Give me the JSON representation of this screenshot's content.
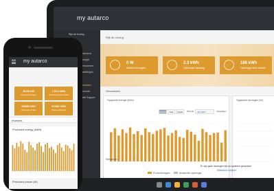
{
  "laptop": {
    "app_name": "my autarco",
    "sidebar": {
      "heading": "Rijk de Koning",
      "items": [
        {
          "label": "Overzicht",
          "active": false
        },
        {
          "label": "Energie",
          "active": false
        },
        {
          "label": "Omvormers",
          "active": false
        },
        {
          "label": "Instellingen",
          "active": false
        },
        {
          "label": "Installatie",
          "active": true
        },
        {
          "label": "Account",
          "active": false
        },
        {
          "label": "Web Support",
          "active": false
        }
      ]
    },
    "breadcrumb": "Rijk de Koning",
    "kpis": [
      {
        "value": "0 W",
        "label": "Actueel vermogen"
      },
      {
        "value": "2.3 kWh",
        "label": "Opbrengst vandaag"
      },
      {
        "value": "186 kWh",
        "label": "Opbrengst deze maand"
      }
    ],
    "section_title": "Omvormers",
    "energy_card": {
      "title": "Opgewekt energie (kWh)",
      "range_tabs": [
        "Maand",
        "Jaar",
        "Totaal"
      ],
      "selected_tab": "Maand",
      "period_label": "Periode",
      "period_value": "Jan 2019",
      "compare_label": "Vergelijken"
    },
    "side_card": {
      "title": "Opgewekt vermogen (W)"
    },
    "legend": [
      "Productiedagen",
      "Verwachte opbrengst"
    ],
    "bottom_title": "Stilstanden",
    "bottom_message": "Er zijn geen storingen bij uw systeem gevonden",
    "bottom_link": "Stilstanden bekijken",
    "accent_color": "#dd9a2e"
  },
  "phone": {
    "app_name": "my autarco",
    "tiles": [
      {
        "value": "15.66 kW",
        "label": "Actueel vermogen"
      },
      {
        "value": "1 514 kWh",
        "label": "Opbrengst deze maand"
      },
      {
        "value": "20835 kWh",
        "label": "Opbrengst dit jaar"
      },
      {
        "value": "32436 kWh",
        "label": "Totale opbrengst"
      }
    ],
    "inverters_label": "Inverters",
    "energy_card_title": "Produced energy (kWh)",
    "power_title": "Produced power (W)"
  },
  "chart_data": [
    {
      "type": "bar",
      "title": "Opgewekt energie (kWh)",
      "categories": [
        "1",
        "2",
        "3",
        "4",
        "5",
        "6",
        "7",
        "8",
        "9",
        "10",
        "11",
        "12",
        "13",
        "14",
        "15",
        "16",
        "17",
        "18",
        "19",
        "20",
        "21",
        "22",
        "23",
        "24",
        "25",
        "26",
        "27",
        "28",
        "29",
        "30",
        "31"
      ],
      "series": [
        {
          "name": "Productiedagen",
          "values": [
            62,
            70,
            55,
            68,
            60,
            72,
            58,
            64,
            56,
            70,
            62,
            58,
            65,
            68,
            71,
            55,
            60,
            66,
            52,
            50,
            67,
            63,
            57,
            44,
            69,
            62,
            56,
            60,
            61,
            40,
            66
          ]
        }
      ],
      "ylim": [
        0,
        80
      ]
    },
    {
      "type": "bar",
      "title": "Produced energy (kWh)",
      "categories": [
        "1",
        "2",
        "3",
        "4",
        "5",
        "6",
        "7",
        "8",
        "9",
        "10",
        "11",
        "12",
        "13",
        "14",
        "15",
        "16",
        "17",
        "18",
        "19",
        "20",
        "21",
        "22",
        "23",
        "24",
        "25",
        "26",
        "27",
        "28",
        "29",
        "30",
        "31"
      ],
      "series": [
        {
          "name": "Produced energy",
          "values": [
            55,
            48,
            60,
            52,
            63,
            58,
            45,
            40,
            62,
            55,
            50,
            44,
            58,
            61,
            53,
            40,
            57,
            60,
            49,
            52,
            46,
            38,
            55,
            59,
            50,
            42,
            56,
            54,
            48,
            44,
            58
          ]
        }
      ],
      "ylim": [
        0,
        80
      ]
    }
  ]
}
